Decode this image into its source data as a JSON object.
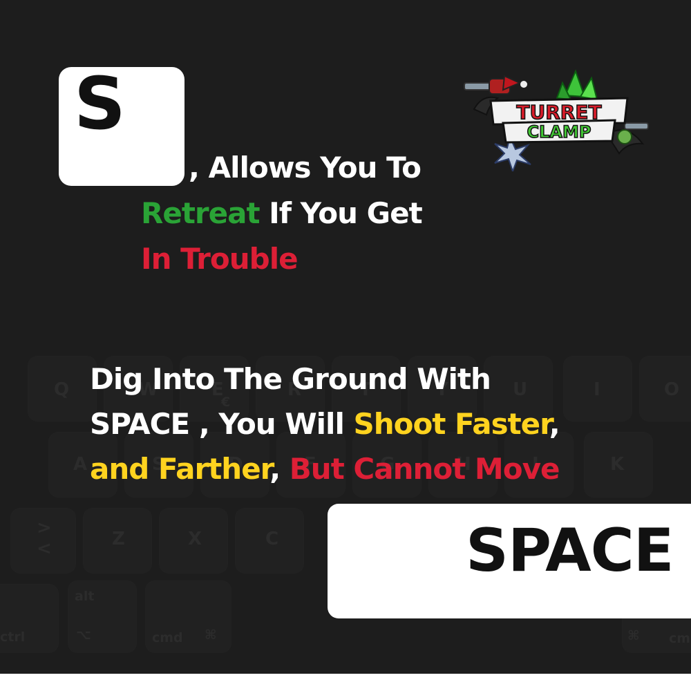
{
  "keys": {
    "s_key": "S",
    "space_key": "SPACE"
  },
  "text_block_1": {
    "line1": ", Allows You To",
    "line2_green": "Retreat",
    "line2_rest": " If You Get",
    "line3_red": "In Trouble"
  },
  "text_block_2": {
    "line1": "Dig Into The Ground With",
    "line2_white": "SPACE , You Will ",
    "line2_yellow": "Shoot Faster",
    "line2_comma": ",",
    "line3_yellow": "and Farther",
    "line3_comma": ", ",
    "line3_red": "But Cannot Move"
  },
  "logo": {
    "line1": "TURRET",
    "line2": "CLAMP"
  },
  "background_keyboard": {
    "keys": [
      "Q",
      "W",
      "E",
      "R",
      "T",
      "Y",
      "U",
      "I",
      "O",
      "A",
      "S",
      "D",
      "F",
      "G",
      "H",
      "J",
      "K",
      "Z",
      "X",
      "C",
      "ctrl",
      "alt",
      "cmd",
      "€",
      "<",
      ">"
    ]
  },
  "colors": {
    "background": "#1d1d1d",
    "green": "#2aa336",
    "red": "#dd1f36",
    "yellow": "#ffd31f"
  }
}
